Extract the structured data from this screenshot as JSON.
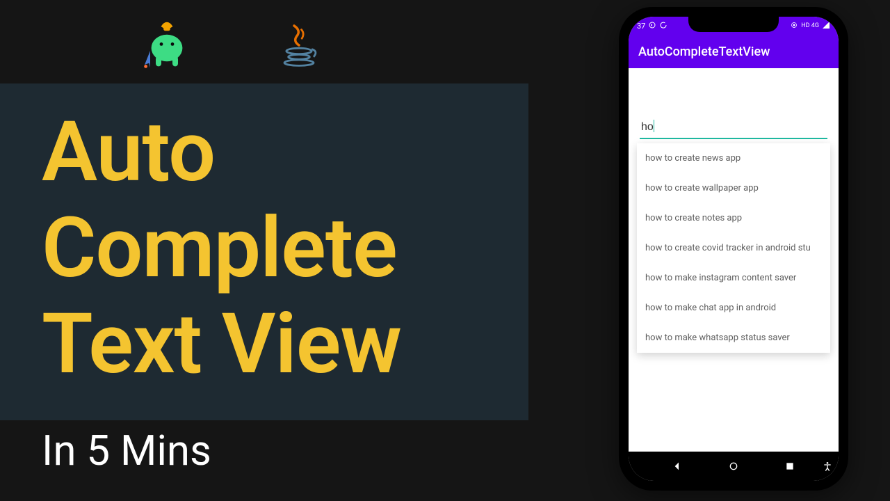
{
  "title": {
    "line1": "Auto",
    "line2": "Complete",
    "line3": "Text View"
  },
  "subtitle": "In 5 Mins",
  "phone": {
    "status": {
      "time": "37",
      "network": "HD 4G"
    },
    "app_bar_title": "AutoCompleteTextView",
    "input_value": "ho",
    "suggestions": [
      "how to create news app",
      "how to create wallpaper app",
      "how to create notes app",
      "how to create covid tracker in android stu",
      "how to make instagram content saver",
      "how to make chat app in android",
      "how to make whatsapp status saver"
    ]
  }
}
